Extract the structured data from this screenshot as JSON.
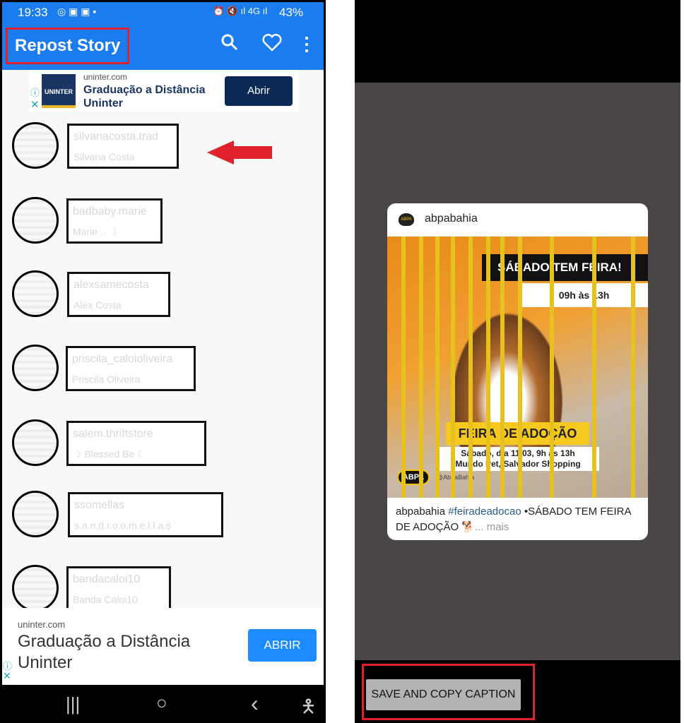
{
  "left_screen": {
    "status": {
      "time": "19:33",
      "battery": "43%"
    },
    "toolbar": {
      "title": "Repost Story",
      "icons": [
        "search-icon",
        "heart-icon",
        "more-vert-icon"
      ]
    },
    "ad_top": {
      "domain": "uninter.com",
      "headline": "Graduação a Distância Uninter",
      "logo_text": "UNINTER",
      "button": "Abrir"
    },
    "users": [
      {
        "username": "silvanacosta.trad",
        "name": "Silvana Costa"
      },
      {
        "username": "badbaby.marie",
        "name": "Marie .. ☽"
      },
      {
        "username": "alexsamecosta",
        "name": "Alex Costa"
      },
      {
        "username": "priscila_caloioliveira",
        "name": "Priscila Oliveira"
      },
      {
        "username": "salem.thriftstore",
        "name": "☽ Blessed Be ☾"
      },
      {
        "username": "ssomellas",
        "name": "s.a.n.d.r.o.o.m.e.l.l.a.s"
      },
      {
        "username": "bandacaloi10",
        "name": "Banda Caloi10"
      }
    ],
    "ad_bottom": {
      "domain": "uninter.com",
      "headline_line1": "Graduação a Distância",
      "headline_line2": "Uninter",
      "button": "ABRIR"
    },
    "nav": {
      "recent": "|||",
      "home": "○",
      "back": "‹",
      "accessibility": "accessibility-icon"
    }
  },
  "right_screen": {
    "post": {
      "account": "abpabahia",
      "image_text": {
        "banner": "SÁBADO TEM FEIRA!",
        "hours": "09h às 13h",
        "event": "FEIRA DE ADOÇÃO",
        "details_line1": "Sábado, dia 11/03, 9h às 13h",
        "details_line2": "Mundo Pet, Salvador Shopping",
        "logo": "ABPA",
        "handle": "@AbpaBahia"
      },
      "caption_user": "abpabahia",
      "caption_hashtag": "#feiradeadocao",
      "caption_text": " •SÁBADO TEM FEIRA DE ADOÇÃO 🐕",
      "more": "... mais"
    },
    "save_button": "SAVE AND COPY CAPTION"
  },
  "colors": {
    "app_bar": "#1b7cf0",
    "highlight": "#e0202a",
    "hashtag": "#2a5d86",
    "ad_button": "#0a2a55",
    "ad_button_bottom": "#1a8cff"
  }
}
